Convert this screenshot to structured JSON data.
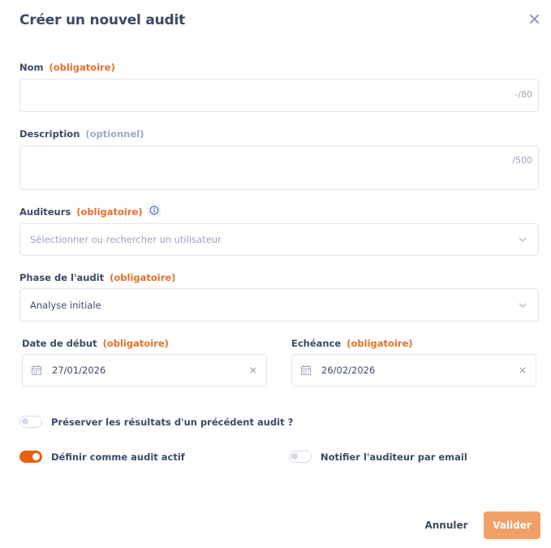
{
  "dialog": {
    "title": "Créer un nouvel audit"
  },
  "fields": {
    "name": {
      "label": "Nom",
      "tag": "(obligatoire)",
      "value": "",
      "counter": "-/80"
    },
    "description": {
      "label": "Description",
      "tag": "(optionnel)",
      "value": "",
      "counter": "/500"
    },
    "auditors": {
      "label": "Auditeurs",
      "tag": "(obligatoire)",
      "placeholder": "Sélectionner ou rechercher un utilisateur"
    },
    "phase": {
      "label": "Phase de l'audit",
      "tag": "(obligatoire)",
      "value": "Analyse initiale"
    },
    "start_date": {
      "label": "Date de début",
      "tag": "(obligatoire)",
      "value": "27/01/2026"
    },
    "due_date": {
      "label": "Echéance",
      "tag": "(obligatoire)",
      "value": "26/02/2026"
    }
  },
  "toggles": {
    "preserve": {
      "label": "Préserver les résultats d'un précédent audit ?",
      "on": false
    },
    "active": {
      "label": "Définir comme audit actif",
      "on": true
    },
    "notify": {
      "label": "Notifier l'auditeur par email",
      "on": false
    }
  },
  "buttons": {
    "cancel": "Annuler",
    "submit": "Valider"
  },
  "colors": {
    "accent": "#e8610f",
    "required": "#e8702a",
    "optional": "#9aaac4",
    "submit_bg": "#f1a06a"
  },
  "icons": {
    "close": "close-icon",
    "info": "info-icon",
    "chevron": "chevron-down-icon",
    "calendar": "calendar-icon",
    "clear": "clear-icon"
  }
}
